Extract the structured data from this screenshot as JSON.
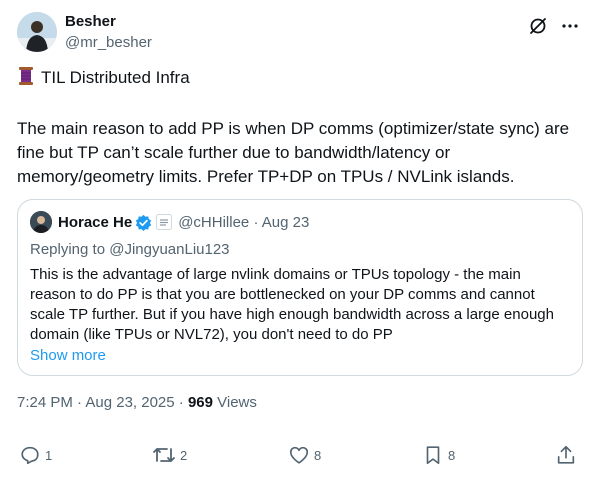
{
  "author": {
    "display_name": "Besher",
    "handle": "@mr_besher"
  },
  "tweet": {
    "line_1": "TIL Distributed Infra",
    "body_lines": [
      "The main reason to add PP is when DP comms (optimizer/state sync) are",
      "fine but TP can’t scale further due to bandwidth/latency or",
      "memory/geometry limits. Prefer TP+DP on TPUs / NVLink islands."
    ]
  },
  "quote": {
    "display_name": "Horace He",
    "handle_and_date": "@cHHillee · Aug 23",
    "replying_to": "Replying to @JingyuanLiu123",
    "body_lines": [
      "This is the advantage of large nvlink domains or TPUs topology - the main",
      "reason to do PP is that you are bottlenecked on your DP comms and cannot",
      "scale TP further. But if you have high enough bandwidth across a large enough",
      "domain (like TPUs or NVL72), you don't need to do PP"
    ],
    "show_more": "Show more"
  },
  "meta": {
    "time_date": "7:24 PM · Aug 23, 2025 · ",
    "views_count": "969",
    "views_label": " Views"
  },
  "actions": {
    "replies": "1",
    "reposts": "2",
    "likes": "8",
    "bookmarks": "8"
  },
  "colors": {
    "text": "#0f1419",
    "secondary": "#536471",
    "link": "#1d9bf0",
    "border": "#cfd9de",
    "verified": "#1d9bf0"
  }
}
